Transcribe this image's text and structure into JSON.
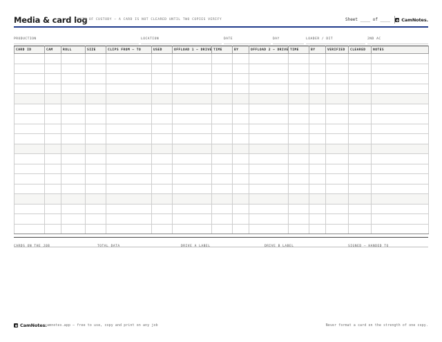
{
  "header": {
    "title": "Media & card log",
    "subtitle": "CHAIN OF CUSTODY — A CARD IS NOT CLEARED UNTIL TWO COPIES VERIFY",
    "sheet": "Sheet ____ of ____",
    "brand": "CamNotes."
  },
  "meta": {
    "production": "PRODUCTION",
    "location": "LOCATION",
    "date": "DATE",
    "day": "DAY",
    "loader": "LOADER / DIT",
    "second_ac": "2ND AC"
  },
  "table": {
    "columns": [
      "CARD ID",
      "CAM",
      "ROLL",
      "SIZE",
      "CLIPS FROM — TO",
      "USED",
      "OFFLOAD 1 — DRIVE",
      "TIME",
      "BY",
      "OFFLOAD 2 — DRIVE",
      "TIME",
      "BY",
      "VERIFIED",
      "CLEARED",
      "NOTES"
    ],
    "rows": [
      [
        "",
        "",
        "",
        "",
        "",
        "",
        "",
        "",
        "",
        "",
        "",
        "",
        "",
        "",
        ""
      ],
      [
        "",
        "",
        "",
        "",
        "",
        "",
        "",
        "",
        "",
        "",
        "",
        "",
        "",
        "",
        ""
      ],
      [
        "",
        "",
        "",
        "",
        "",
        "",
        "",
        "",
        "",
        "",
        "",
        "",
        "",
        "",
        ""
      ],
      [
        "",
        "",
        "",
        "",
        "",
        "",
        "",
        "",
        "",
        "",
        "",
        "",
        "",
        "",
        ""
      ],
      [
        "",
        "",
        "",
        "",
        "",
        "",
        "",
        "",
        "",
        "",
        "",
        "",
        "",
        "",
        ""
      ],
      [
        "",
        "",
        "",
        "",
        "",
        "",
        "",
        "",
        "",
        "",
        "",
        "",
        "",
        "",
        ""
      ],
      [
        "",
        "",
        "",
        "",
        "",
        "",
        "",
        "",
        "",
        "",
        "",
        "",
        "",
        "",
        ""
      ],
      [
        "",
        "",
        "",
        "",
        "",
        "",
        "",
        "",
        "",
        "",
        "",
        "",
        "",
        "",
        ""
      ],
      [
        "",
        "",
        "",
        "",
        "",
        "",
        "",
        "",
        "",
        "",
        "",
        "",
        "",
        "",
        ""
      ],
      [
        "",
        "",
        "",
        "",
        "",
        "",
        "",
        "",
        "",
        "",
        "",
        "",
        "",
        "",
        ""
      ],
      [
        "",
        "",
        "",
        "",
        "",
        "",
        "",
        "",
        "",
        "",
        "",
        "",
        "",
        "",
        ""
      ],
      [
        "",
        "",
        "",
        "",
        "",
        "",
        "",
        "",
        "",
        "",
        "",
        "",
        "",
        "",
        ""
      ],
      [
        "",
        "",
        "",
        "",
        "",
        "",
        "",
        "",
        "",
        "",
        "",
        "",
        "",
        "",
        ""
      ],
      [
        "",
        "",
        "",
        "",
        "",
        "",
        "",
        "",
        "",
        "",
        "",
        "",
        "",
        "",
        ""
      ],
      [
        "",
        "",
        "",
        "",
        "",
        "",
        "",
        "",
        "",
        "",
        "",
        "",
        "",
        "",
        ""
      ],
      [
        "",
        "",
        "",
        "",
        "",
        "",
        "",
        "",
        "",
        "",
        "",
        "",
        "",
        "",
        ""
      ],
      [
        "",
        "",
        "",
        "",
        "",
        "",
        "",
        "",
        "",
        "",
        "",
        "",
        "",
        "",
        ""
      ],
      [
        "",
        "",
        "",
        "",
        "",
        "",
        "",
        "",
        "",
        "",
        "",
        "",
        "",
        "",
        ""
      ]
    ],
    "shaded_rows": [
      4,
      9,
      14
    ]
  },
  "footer": {
    "cards_on_job": "CARDS ON THE JOB",
    "total_data": "TOTAL DATA",
    "drive_a": "DRIVE A LABEL",
    "drive_b": "DRIVE B LABEL",
    "signed": "SIGNED — HANDED TO"
  },
  "bottom": {
    "brand": "CamNotes.",
    "note": "camnotes.app — free to use, copy and print on any job",
    "tagline": "Never format a card on the strength of one copy."
  },
  "colors": {
    "accent_rule": "#1f3a8a",
    "text": "#1b1b1b",
    "shade": "#f6f6f4"
  }
}
